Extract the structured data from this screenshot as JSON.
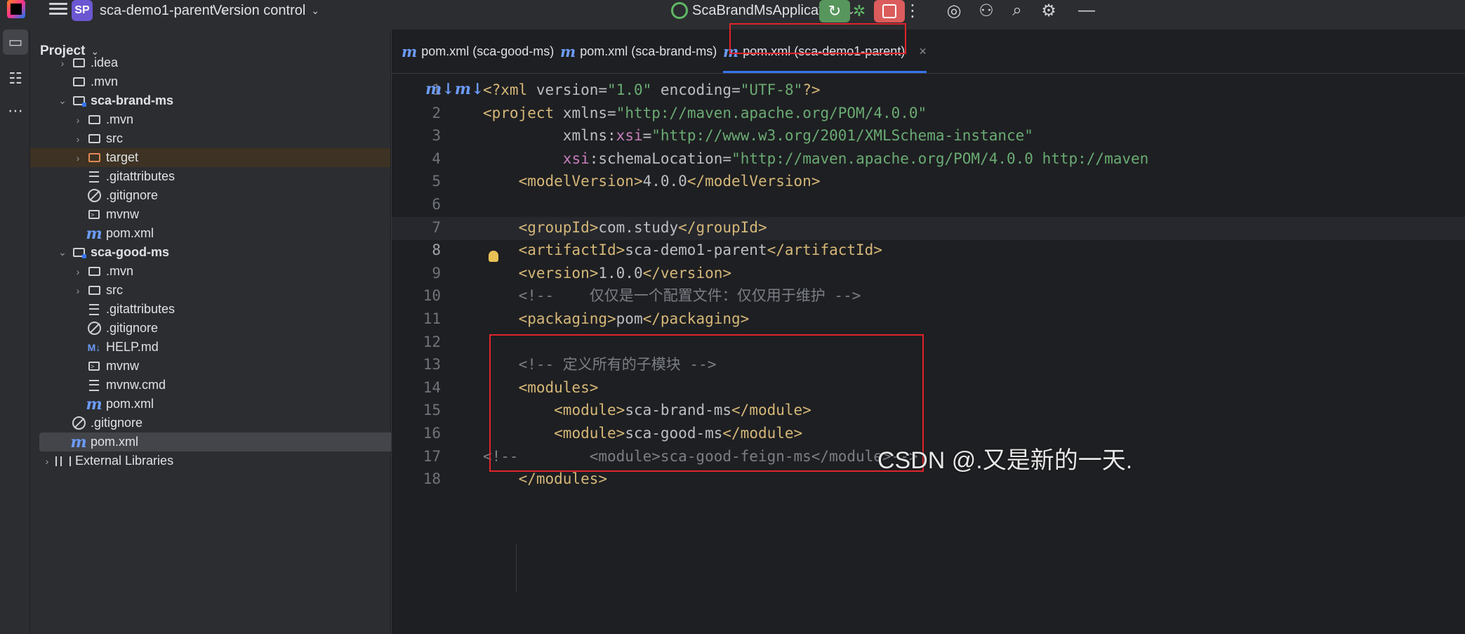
{
  "titlebar": {
    "project_badge": "SP",
    "project_name": "sca-demo1-parent",
    "vcs": "Version control",
    "run_config": "ScaBrandMsApplication"
  },
  "project_panel": {
    "title": "Project",
    "tree": [
      {
        "label": ".idea",
        "icon": "folder-icon",
        "level": 1,
        "arrow": "›"
      },
      {
        "label": ".mvn",
        "icon": "folder-icon",
        "level": 1,
        "arrow": ""
      },
      {
        "label": "sca-brand-ms",
        "icon": "module-folder-icon",
        "level": 1,
        "arrow": "⌄",
        "bold": true
      },
      {
        "label": ".mvn",
        "icon": "folder-icon",
        "level": 2,
        "arrow": "›"
      },
      {
        "label": "src",
        "icon": "folder-icon",
        "level": 2,
        "arrow": "›"
      },
      {
        "label": "target",
        "icon": "excluded-folder-icon",
        "level": 2,
        "arrow": "›",
        "highlight": true
      },
      {
        "label": ".gitattributes",
        "icon": "text-file-icon",
        "level": 2,
        "arrow": ""
      },
      {
        "label": ".gitignore",
        "icon": "ignore-file-icon",
        "level": 2,
        "arrow": ""
      },
      {
        "label": "mvnw",
        "icon": "shell-script-icon",
        "level": 2,
        "arrow": ""
      },
      {
        "label": "pom.xml",
        "icon": "maven-icon",
        "level": 2,
        "arrow": ""
      },
      {
        "label": "sca-good-ms",
        "icon": "module-folder-icon",
        "level": 1,
        "arrow": "⌄",
        "bold": true
      },
      {
        "label": ".mvn",
        "icon": "folder-icon",
        "level": 2,
        "arrow": "›"
      },
      {
        "label": "src",
        "icon": "folder-icon",
        "level": 2,
        "arrow": "›"
      },
      {
        "label": ".gitattributes",
        "icon": "text-file-icon",
        "level": 2,
        "arrow": ""
      },
      {
        "label": ".gitignore",
        "icon": "ignore-file-icon",
        "level": 2,
        "arrow": ""
      },
      {
        "label": "HELP.md",
        "icon": "markdown-icon",
        "level": 2,
        "arrow": ""
      },
      {
        "label": "mvnw",
        "icon": "shell-script-icon",
        "level": 2,
        "arrow": ""
      },
      {
        "label": "mvnw.cmd",
        "icon": "text-file-icon",
        "level": 2,
        "arrow": ""
      },
      {
        "label": "pom.xml",
        "icon": "maven-icon",
        "level": 2,
        "arrow": ""
      },
      {
        "label": ".gitignore",
        "icon": "ignore-file-icon",
        "level": 1,
        "arrow": ""
      },
      {
        "label": "pom.xml",
        "icon": "maven-icon",
        "level": 1,
        "arrow": "",
        "selected": true
      },
      {
        "label": "External Libraries",
        "icon": "library-icon",
        "level": 0,
        "arrow": "›"
      }
    ]
  },
  "editor": {
    "tabs": [
      {
        "label": "pom.xml (sca-good-ms)"
      },
      {
        "label": "pom.xml (sca-brand-ms)"
      },
      {
        "label": "pom.xml (sca-demo1-parent)",
        "active": true,
        "close": "×"
      }
    ],
    "gutter_icon": "m↓m↓",
    "current_line": 8,
    "lines": [
      {
        "n": "1",
        "html": "<span class='tag'>&lt;?xml</span> <span class='attr'>version</span>=<span class='str'>\"1.0\"</span> <span class='attr'>encoding</span>=<span class='str'>\"UTF-8\"</span><span class='tag'>?&gt;</span>"
      },
      {
        "n": "2",
        "html": "<span class='tag'>&lt;project</span> <span class='attr'>xmlns</span>=<span class='str'>\"http://maven.apache.org/POM/4.0.0\"</span>"
      },
      {
        "n": "3",
        "html": "         <span class='attr'>xmlns</span>:<span class='ns'>xsi</span>=<span class='str'>\"http://www.w3.org/2001/XMLSchema-instance\"</span>"
      },
      {
        "n": "4",
        "html": "         <span class='ns'>xsi</span>:<span class='attr'>schemaLocation</span>=<span class='str'>\"http://maven.apache.org/POM/4.0.0 http://maven</span>"
      },
      {
        "n": "5",
        "html": "    <span class='tag'>&lt;modelVersion&gt;</span>4.0.0<span class='tag'>&lt;/modelVersion&gt;</span>"
      },
      {
        "n": "6",
        "html": ""
      },
      {
        "n": "7",
        "html": "    <span class='tag'>&lt;groupId&gt;</span>com.study<span class='tag'>&lt;/groupId&gt;</span>"
      },
      {
        "n": "8",
        "html": "    <span class='tag'>&lt;artifactId&gt;</span>sca-demo1-parent<span class='tag'>&lt;/artifactId&gt;</span>"
      },
      {
        "n": "9",
        "html": "    <span class='tag'>&lt;version&gt;</span>1.0.0<span class='tag'>&lt;/version&gt;</span>"
      },
      {
        "n": "10",
        "html": "    <span class='cmt'>&lt;!--    仅仅是一个配置文件：仅仅用于维护 --&gt;</span>"
      },
      {
        "n": "11",
        "html": "    <span class='tag'>&lt;packaging&gt;</span>pom<span class='tag'>&lt;/packaging&gt;</span>"
      },
      {
        "n": "12",
        "html": ""
      },
      {
        "n": "13",
        "html": "    <span class='cmt'>&lt;!-- 定义所有的子模块 --&gt;</span>"
      },
      {
        "n": "14",
        "html": "    <span class='tag'>&lt;modules&gt;</span>"
      },
      {
        "n": "15",
        "html": "        <span class='tag'>&lt;module&gt;</span>sca-brand-ms<span class='tag'>&lt;/module&gt;</span>"
      },
      {
        "n": "16",
        "html": "        <span class='tag'>&lt;module&gt;</span>sca-good-ms<span class='tag'>&lt;/module&gt;</span>"
      },
      {
        "n": "17",
        "html": "<span class='cmt'>&lt;!--        &lt;module&gt;sca-good-feign-ms&lt;/module&gt;--&gt;</span>"
      },
      {
        "n": "18",
        "html": "    <span class='tag'>&lt;/modules&gt;</span>"
      }
    ]
  },
  "watermark": "CSDN @.又是新的一天.",
  "colors": {
    "accent": "#3574f0",
    "run_green": "#57965c",
    "stop_red": "#db5c5c",
    "annotation_red": "#e0242b"
  }
}
